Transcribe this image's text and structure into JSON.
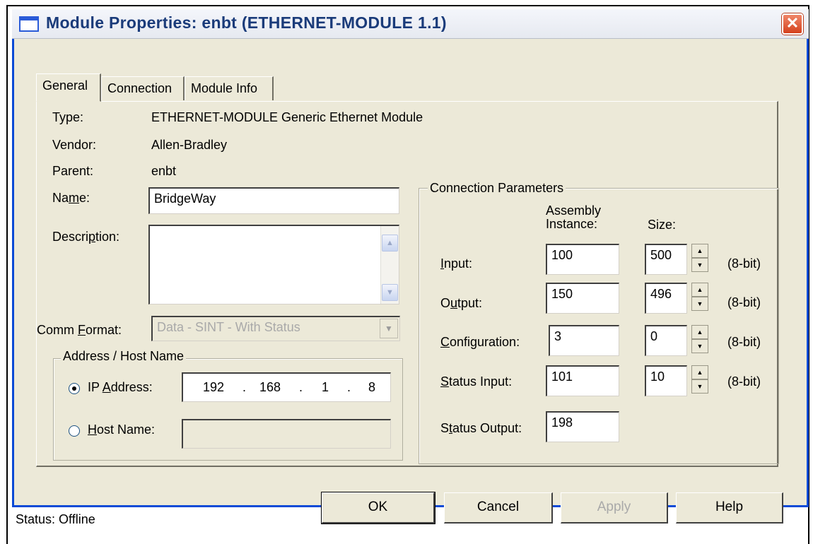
{
  "window": {
    "title": "Module Properties: enbt (ETHERNET-MODULE 1.1)",
    "close_glyph": "✕"
  },
  "tabs": [
    {
      "label": "General"
    },
    {
      "label": "Connection"
    },
    {
      "label": "Module Info"
    }
  ],
  "general": {
    "type_label": "Type:",
    "type_value": "ETHERNET-MODULE Generic Ethernet Module",
    "vendor_label": "Vendor:",
    "vendor_value": "Allen-Bradley",
    "parent_label": "Parent:",
    "parent_value": "enbt",
    "name_label_pre": "Na",
    "name_label_ul": "m",
    "name_label_post": "e:",
    "name_value": "BridgeWay",
    "description_label_pre": "Descri",
    "description_label_ul": "p",
    "description_label_post": "tion:",
    "description_value": "",
    "comm_format_label_pre": "Comm ",
    "comm_format_label_ul": "F",
    "comm_format_label_post": "ormat:",
    "comm_format_value": "Data - SINT - With Status"
  },
  "address": {
    "group_title": "Address / Host Name",
    "ip_label_pre": "IP ",
    "ip_label_ul": "A",
    "ip_label_post": "ddress:",
    "ip_octets": [
      "192",
      "168",
      "1",
      "8"
    ],
    "ip_dot": ".",
    "host_label_ul": "H",
    "host_label_post": "ost Name:",
    "host_value": "",
    "selected": "ip"
  },
  "connection_parameters": {
    "group_title": "Connection Parameters",
    "col_assembly_line1": "Assembly",
    "col_assembly_line2": "Instance:",
    "col_size": "Size:",
    "unit": "(8-bit)",
    "rows": [
      {
        "label_pre": "",
        "label_ul": "I",
        "label_post": "nput:",
        "instance": "100",
        "size": "500"
      },
      {
        "label_pre": "O",
        "label_ul": "u",
        "label_post": "tput:",
        "instance": "150",
        "size": "496"
      },
      {
        "label_pre": "",
        "label_ul": "C",
        "label_post": "onfiguration:",
        "instance": "3",
        "size": "0"
      },
      {
        "label_pre": "",
        "label_ul": "S",
        "label_post": "tatus Input:",
        "instance": "101",
        "size": "10"
      },
      {
        "label_pre": "S",
        "label_ul": "t",
        "label_post": "atus Output:",
        "instance": "198",
        "size": ""
      }
    ]
  },
  "footer": {
    "status_text": "Status:  Offline",
    "ok_label": "OK",
    "cancel_label": "Cancel",
    "apply_label": "Apply",
    "help_label": "Help"
  },
  "icons": {
    "spin_up": "▲",
    "spin_down": "▼",
    "scroll_up": "▲",
    "scroll_down": "▼",
    "combo_down": "▼"
  },
  "colors": {
    "title_text": "#1a3b7a",
    "close_button": "#d4411d",
    "dialog_bg": "#ece9d8",
    "frame_blue": "#0a4ad6"
  }
}
